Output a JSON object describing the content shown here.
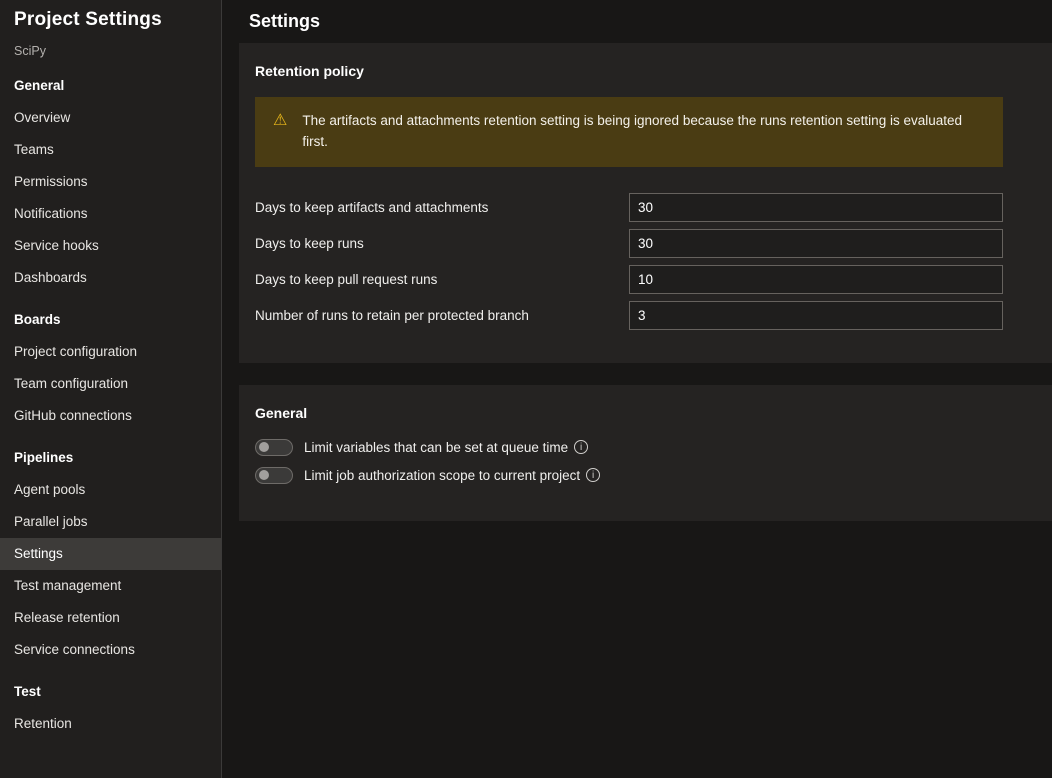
{
  "sidebar": {
    "title": "Project Settings",
    "subtitle": "SciPy",
    "sections": [
      {
        "header": "General",
        "items": [
          "Overview",
          "Teams",
          "Permissions",
          "Notifications",
          "Service hooks",
          "Dashboards"
        ]
      },
      {
        "header": "Boards",
        "items": [
          "Project configuration",
          "Team configuration",
          "GitHub connections"
        ]
      },
      {
        "header": "Pipelines",
        "items": [
          "Agent pools",
          "Parallel jobs",
          "Settings",
          "Test management",
          "Release retention",
          "Service connections"
        ]
      },
      {
        "header": "Test",
        "items": [
          "Retention"
        ]
      }
    ],
    "selected_item": "Settings"
  },
  "main": {
    "title": "Settings",
    "retention_card": {
      "title": "Retention policy",
      "warning": "The artifacts and attachments retention setting is being ignored because the runs retention setting is evaluated first.",
      "fields": [
        {
          "label": "Days to keep artifacts and attachments",
          "value": "30"
        },
        {
          "label": "Days to keep runs",
          "value": "30"
        },
        {
          "label": "Days to keep pull request runs",
          "value": "10"
        },
        {
          "label": "Number of runs to retain per protected branch",
          "value": "3"
        }
      ]
    },
    "general_card": {
      "title": "General",
      "toggles": [
        {
          "label": "Limit variables that can be set at queue time",
          "state": "off"
        },
        {
          "label": "Limit job authorization scope to current project",
          "state": "off"
        }
      ]
    }
  },
  "icons": {
    "warning": "⚠",
    "info": "i"
  },
  "colors": {
    "page_bg": "#181716",
    "sidebar_bg": "#211f1e",
    "card_bg": "#252322",
    "selected_item_bg": "#3d3b39",
    "warning_bg": "#4a3c13",
    "warning_icon": "#e8b71a",
    "input_border": "#66625e"
  }
}
